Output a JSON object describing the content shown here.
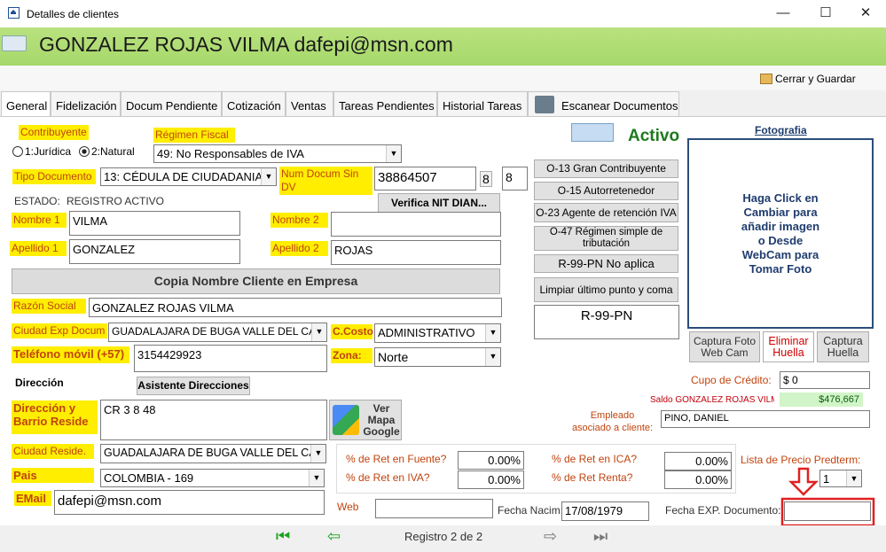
{
  "window": {
    "title": "Detalles de clientes",
    "minimize": "—",
    "maximize": "☐",
    "close": "✕"
  },
  "header": {
    "name": "GONZALEZ ROJAS VILMA  dafepi@msn.com"
  },
  "toolbar": {
    "close_save": "Cerrar y Guardar"
  },
  "tabs": [
    "General",
    "Fidelización",
    "Docum Pendiente",
    "Cotización",
    "Ventas",
    "Tareas Pendientes",
    "Historial Tareas",
    "Escanear Documentos"
  ],
  "form": {
    "contribuyente_label": "Contribuyente",
    "juridica": "1:Jurídica",
    "natural": "2:Natural",
    "regimen_label": "Régimen Fiscal",
    "regimen_value": "49: No Responsables de IVA",
    "estado_activo": "Activo",
    "tipo_doc_label": "Tipo Documento",
    "tipo_doc_value": "13: CÉDULA DE CIUDADANIA",
    "num_doc_label": "Num Docum Sin DV",
    "num_doc_value": "38864507",
    "dv1": "8",
    "dv2": "8",
    "estado_label": "ESTADO:",
    "estado_value": "REGISTRO ACTIVO",
    "verifica": "Verifica NIT DIAN...",
    "nombre1_label": "Nombre 1",
    "nombre1_value": "VILMA",
    "nombre2_label": "Nombre 2",
    "nombre2_value": "",
    "apellido1_label": "Apellido 1",
    "apellido1_value": "GONZALEZ",
    "apellido2_label": "Apellido 2",
    "apellido2_value": "ROJAS",
    "copia": "Copia Nombre Cliente en Empresa",
    "razon_label": "Razón Social",
    "razon_value": "GONZALEZ ROJAS VILMA",
    "ciudad_exp_label": "Ciudad Exp Docum",
    "ciudad_exp_value": "GUADALAJARA DE BUGA  VALLE DEL CAUC",
    "ccosto_label": "C.Costo",
    "ccosto_value": "ADMINISTRATIVO",
    "telefono_label": "Teléfono móvil (+57)",
    "telefono_value": "3154429923",
    "zona_label": "Zona:",
    "zona_value": "Norte",
    "direccion_label": "Dirección",
    "asistente": "Asistente Direcciones",
    "dir_barrio_label": "Dirección y Barrio Reside",
    "dir_value": "CR 3 8 48",
    "ver_mapa": "Ver Mapa Google",
    "ciudad_res_label": "Ciudad Reside.",
    "ciudad_res_value": "GUADALAJARA DE BUGA  VALLE DEL CA",
    "pais_label": "Pais",
    "pais_value": "COLOMBIA - 169",
    "email_label": "EMail",
    "email_value": "dafepi@msn.com"
  },
  "right": {
    "o13": "O-13 Gran Contribuyente",
    "o15": "O-15 Autorretenedor",
    "o23": "O-23 Agente de retención IVA",
    "o47": "O-47 Régimen simple de tributación",
    "r99": "R-99-PN No aplica",
    "limpiar": "Limpiar último punto y coma",
    "resp_value": "R-99-PN",
    "foto_label": "Fotografia",
    "foto_text": "Haga Click en Cambiar para añadir imagen o Desde WebCam para Tomar Foto",
    "captura_foto": "Captura Foto Web Cam",
    "eliminar_huella": "Eliminar Huella",
    "captura_huella": "Captura Huella",
    "cupo_label": "Cupo de Crédito:",
    "cupo_value": "$ 0",
    "saldo_label": "Saldo GONZALEZ ROJAS VILM",
    "saldo_value": "$476,667",
    "empleado_label": "Empleado asociado a cliente:",
    "empleado_value": "PINO, DANIEL",
    "ret_fuente_label": "% de Ret en Fuente?",
    "ret_fuente": "0.00%",
    "ret_ica_label": "% de Ret en ICA?",
    "ret_ica": "0.00%",
    "ret_iva_label": "% de Ret en IVA?",
    "ret_iva": "0.00%",
    "ret_renta_label": "% de Ret Renta?",
    "ret_renta": "0.00%",
    "lista_label": "Lista de Precio Predterm:",
    "lista_value": "1",
    "web_label": "Web",
    "web_value": "",
    "fecha_nacim_label": "Fecha Nacim:",
    "fecha_nacim": "17/08/1979",
    "fecha_exp_label": "Fecha EXP. Documento:",
    "fecha_exp": ""
  },
  "footer": {
    "registro": "Registro 2 de 2"
  },
  "colors": {
    "header": "#a6d86a",
    "highlight": "#ffee00",
    "label_text": "#c1440e",
    "active": "#1e7a1e",
    "annotation": "#e02020"
  }
}
